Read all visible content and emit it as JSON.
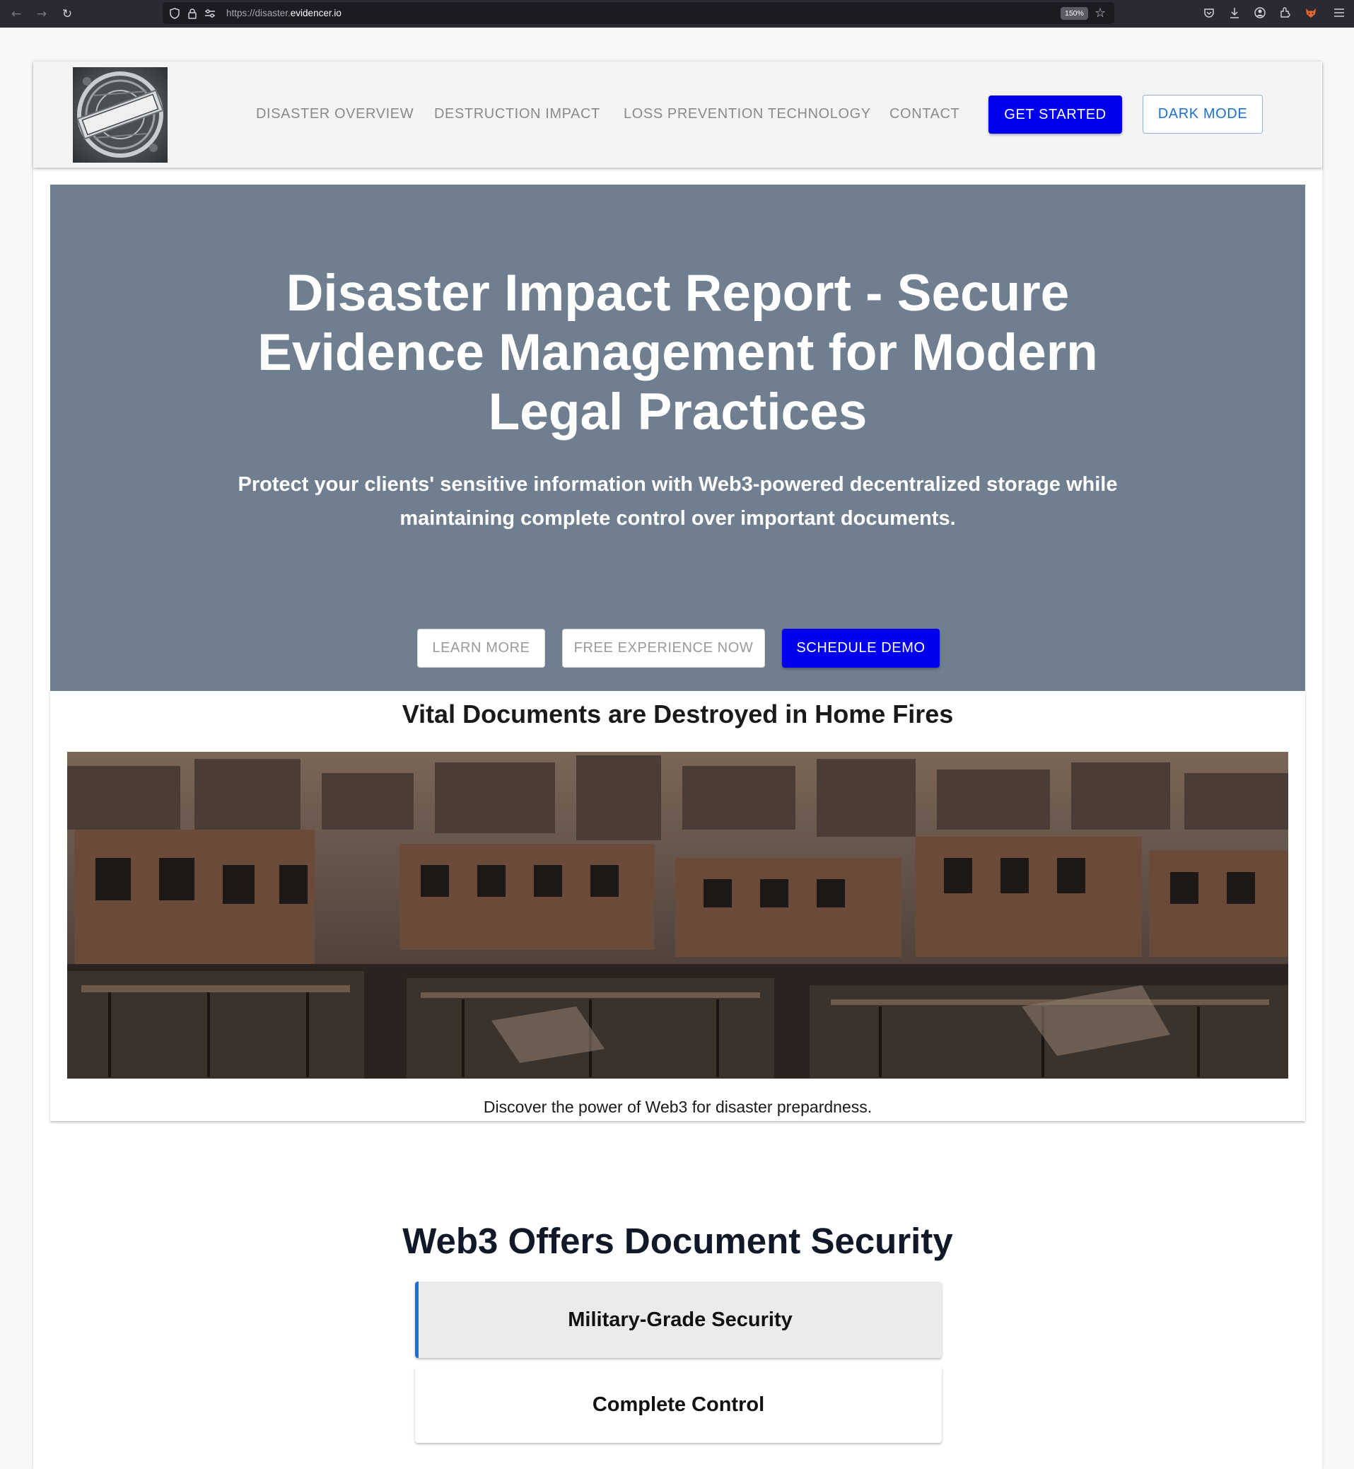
{
  "browser": {
    "url_prefix": "https://disaster.",
    "url_host": "evidencer.io",
    "zoom": "150%"
  },
  "header": {
    "logo_alt": "Web3 Legal Engineering",
    "nav": [
      {
        "label": "DISASTER OVERVIEW"
      },
      {
        "label": "DESTRUCTION IMPACT"
      },
      {
        "label": "LOSS PREVENTION TECHNOLOGY"
      },
      {
        "label": "CONTACT"
      }
    ],
    "get_started": "GET STARTED",
    "dark_mode": "DARK MODE"
  },
  "hero": {
    "title": "Disaster Impact Report - Secure Evidence Management for Modern Legal Practices",
    "subtitle": "Protect your clients' sensitive information with Web3-powered decentralized storage while maintaining complete control over important documents.",
    "learn_more": "LEARN MORE",
    "free_experience": "FREE EXPERIENCE NOW",
    "schedule_demo": "SCHEDULE DEMO"
  },
  "card": {
    "title": "Vital Documents are Destroyed in Home Fires",
    "caption": "Discover the power of Web3 for disaster prepardness."
  },
  "security": {
    "title": "Web3 Offers Document Security",
    "features": [
      {
        "label": "Military-Grade Security",
        "active": true
      },
      {
        "label": "Complete Control",
        "active": false
      }
    ]
  },
  "colors": {
    "primary": "#0000ee",
    "hero_bg": "#6f7f8f",
    "accent": "#1f6fd1"
  }
}
